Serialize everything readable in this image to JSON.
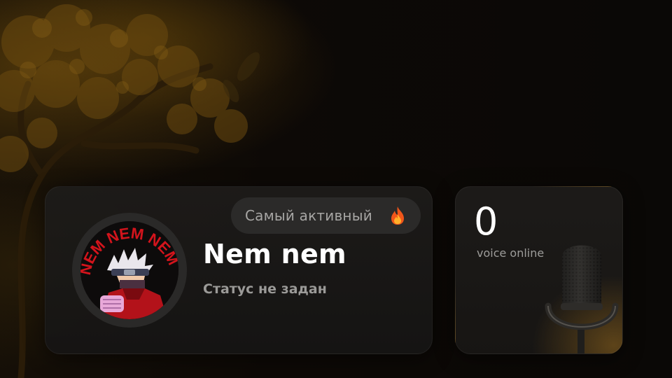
{
  "profile": {
    "badge_label": "Самый активный",
    "badge_icon": "fire-icon",
    "username": "Nem nem",
    "status": "Статус не задан",
    "avatar_text": "NEM NEM NEM"
  },
  "voice": {
    "count": "0",
    "label": "voice online",
    "icon": "microphone-icon"
  },
  "colors": {
    "background": "#0b0806",
    "card": "#1c1b1a",
    "badge_bg": "#2b2a29",
    "accent_gold": "#96691e",
    "avatar_red": "#c8121b",
    "text_primary": "#ffffff",
    "text_muted": "#9b9a98"
  }
}
